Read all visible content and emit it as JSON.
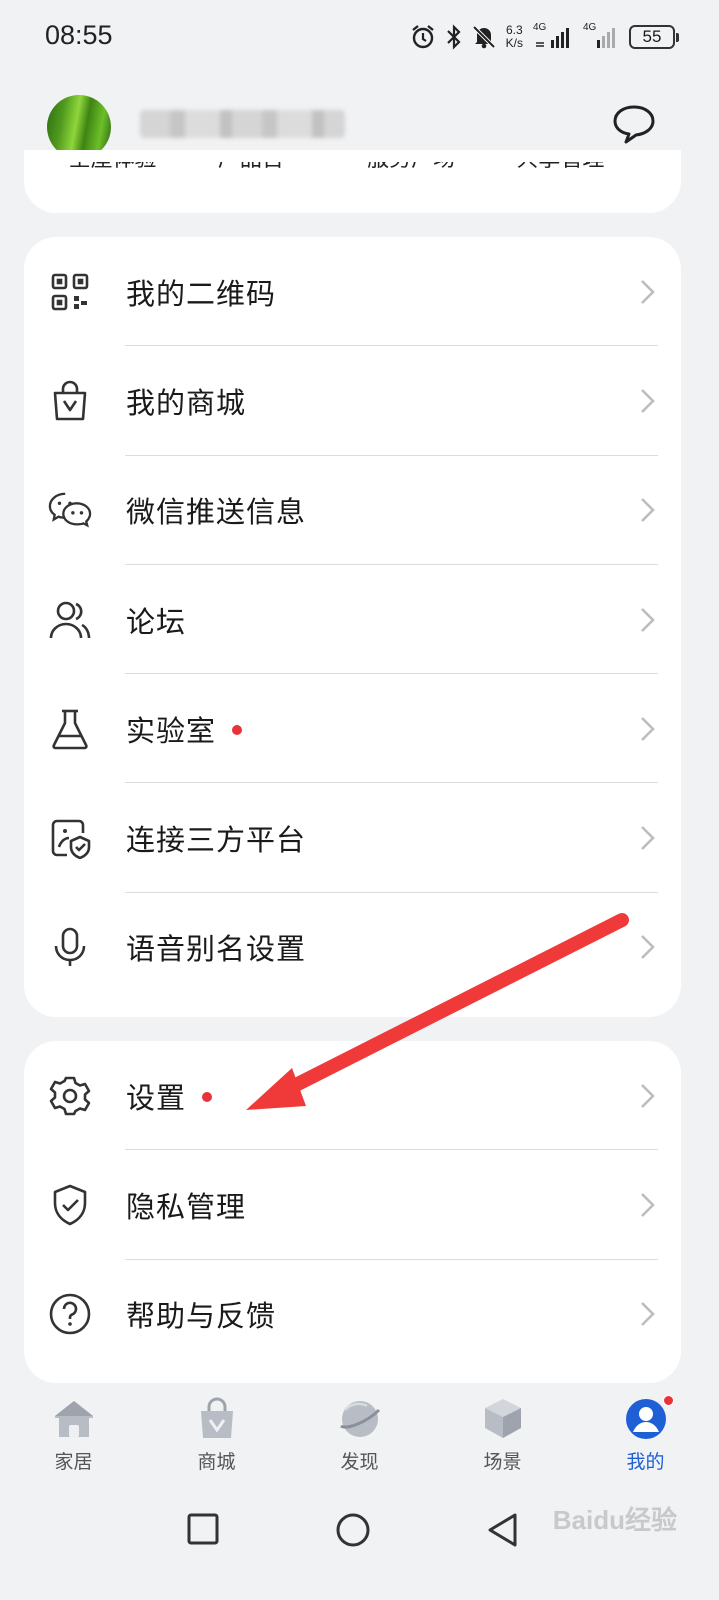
{
  "status_bar": {
    "time": "08:55",
    "net_speed_top": "6.3",
    "net_speed_bottom": "K/s",
    "network_1": "4G",
    "network_2": "4G",
    "battery": "55"
  },
  "profile": {
    "message_icon": "chat-bubble-icon"
  },
  "shortcuts": [
    "全屋体验",
    "产品百",
    "服务广场",
    "共享管理"
  ],
  "menu_card_1": [
    {
      "label": "我的二维码",
      "icon": "qr-code-icon",
      "dot": false
    },
    {
      "label": "我的商城",
      "icon": "shopping-bag-icon",
      "dot": false
    },
    {
      "label": "微信推送信息",
      "icon": "wechat-icon",
      "dot": false
    },
    {
      "label": "论坛",
      "icon": "users-icon",
      "dot": false
    },
    {
      "label": "实验室",
      "icon": "flask-icon",
      "dot": true
    },
    {
      "label": "连接三方平台",
      "icon": "third-party-icon",
      "dot": false
    },
    {
      "label": "语音别名设置",
      "icon": "microphone-icon",
      "dot": false
    }
  ],
  "menu_card_2": [
    {
      "label": "设置",
      "icon": "gear-icon",
      "dot": true
    },
    {
      "label": "隐私管理",
      "icon": "shield-check-icon",
      "dot": false
    },
    {
      "label": "帮助与反馈",
      "icon": "help-icon",
      "dot": false
    }
  ],
  "bottom_nav": [
    {
      "label": "家居",
      "icon": "home-icon",
      "active": false
    },
    {
      "label": "商城",
      "icon": "mall-icon",
      "active": false
    },
    {
      "label": "发现",
      "icon": "planet-icon",
      "active": false
    },
    {
      "label": "场景",
      "icon": "cube-icon",
      "active": false
    },
    {
      "label": "我的",
      "icon": "profile-icon",
      "active": true
    }
  ],
  "watermark": "Baidu经验",
  "colors": {
    "accent": "#1f5fd6",
    "badge": "#e8333a",
    "annotation_arrow": "#f03a3a",
    "background": "#f1f2f4"
  }
}
